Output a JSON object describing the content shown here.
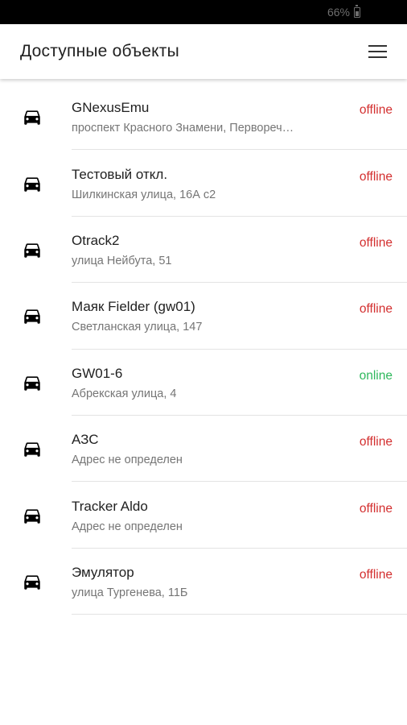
{
  "status_bar": {
    "battery_text": "66%"
  },
  "app_bar": {
    "title": "Доступные объекты",
    "menu_icon": "hamburger-menu-icon"
  },
  "colors": {
    "offline": "#d32f2f",
    "online": "#2eb85c"
  },
  "objects": [
    {
      "name": "GNexusEmu",
      "address": "проспект Красного Знамени, Первореч…",
      "status": "offline"
    },
    {
      "name": "Тестовый откл.",
      "address": "Шилкинская улица, 16А с2",
      "status": "offline"
    },
    {
      "name": "Otrack2",
      "address": "улица Нейбута, 51",
      "status": "offline"
    },
    {
      "name": "Маяк Fielder (gw01)",
      "address": "Светланская улица, 147",
      "status": "offline"
    },
    {
      "name": "GW01-6",
      "address": "Абрекская улица, 4",
      "status": "online"
    },
    {
      "name": "АЗС",
      "address": "Адрес не определен",
      "status": "offline"
    },
    {
      "name": "Tracker Aldo",
      "address": "Адрес не определен",
      "status": "offline"
    },
    {
      "name": "Эмулятор",
      "address": "улица Тургенева, 11Б",
      "status": "offline"
    }
  ]
}
